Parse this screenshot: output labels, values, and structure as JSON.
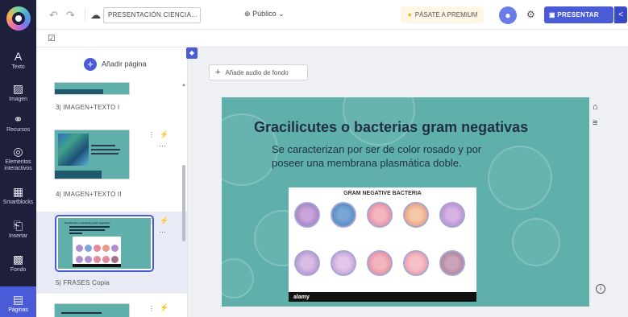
{
  "rail": {
    "items": [
      {
        "label": "Texto",
        "icon": "text-icon"
      },
      {
        "label": "Imagen",
        "icon": "image-icon"
      },
      {
        "label": "Recursos",
        "icon": "resources-icon"
      },
      {
        "label": "Elementos interactivos",
        "icon": "interactive-icon"
      },
      {
        "label": "Smartblocks",
        "icon": "smartblocks-icon"
      },
      {
        "label": "Insertar",
        "icon": "insert-icon"
      },
      {
        "label": "Fondo",
        "icon": "background-icon"
      },
      {
        "label": "Páginas",
        "icon": "pages-icon"
      }
    ]
  },
  "topbar": {
    "title": "PRESENTACIÓN CIENCIA...",
    "visibility": "Público",
    "premium": "PÁSATE A PREMIUM",
    "present": "PRESENTAR"
  },
  "pages": {
    "add_label": "Añadir página",
    "items": [
      {
        "label": "3| IMAGEN+TEXTO I"
      },
      {
        "label": "4| IMAGEN+TEXTO II"
      },
      {
        "label": "5| FRASES Copia"
      }
    ],
    "thumb_title": "Gracilicutes o bacterias gram negativas"
  },
  "canvas": {
    "audio_label": "Añade audio de fondo",
    "slide_title": "Gracilicutes o bacterias gram negativas",
    "slide_body": "Se caracterizan por ser de color rosado y por poseer una membrana plasmática doble.",
    "image_title": "GRAM NEGATIVE BACTERIA",
    "image_brand": "alamy"
  },
  "colors": {
    "rail_bg": "#1d1f3b",
    "accent": "#4a5bd8",
    "slide_bg": "#5fb0aa",
    "premium_star": "#f5a623"
  }
}
